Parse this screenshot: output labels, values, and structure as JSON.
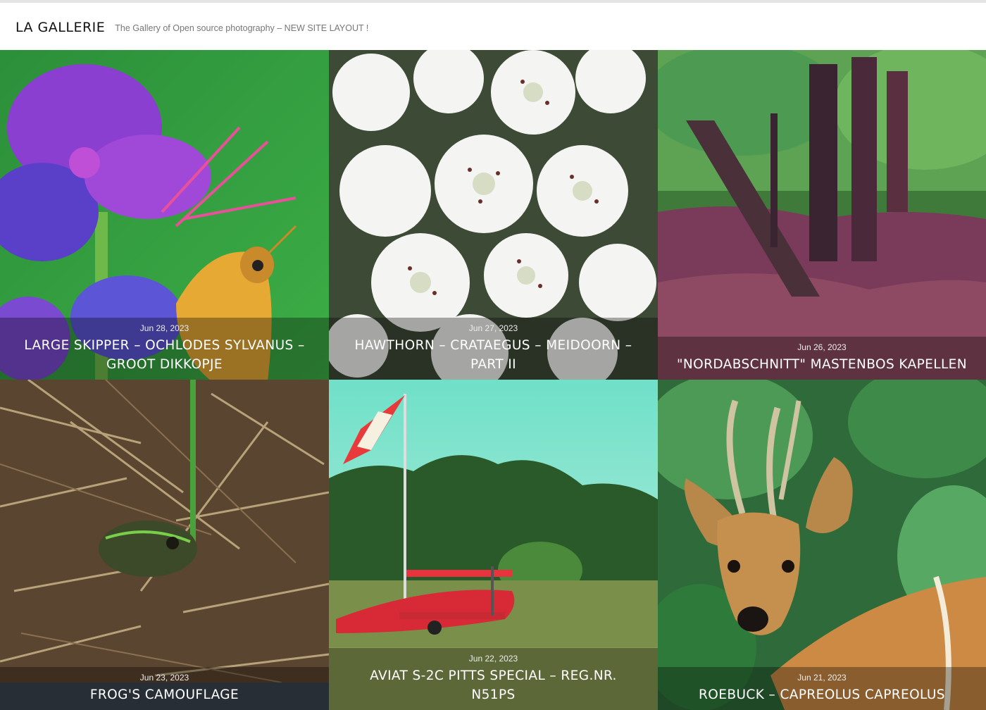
{
  "site": {
    "title": "LA GALLERIE",
    "tagline": "The Gallery of Open source photography – NEW SITE LAYOUT !"
  },
  "posts": [
    {
      "date": "Jun 28, 2023",
      "title": "LARGE SKIPPER – OCHLODES SYLVANUS – GROOT DIKKOPJE",
      "image": "skipper-butterfly-on-purple-flowers"
    },
    {
      "date": "Jun 27, 2023",
      "title": "HAWTHORN – CRATAEGUS – MEIDOORN – PART II",
      "image": "white-hawthorn-blossoms"
    },
    {
      "date": "Jun 26, 2023",
      "title": "\"NORDABSCHNITT\" MASTENBOS KAPELLEN",
      "image": "forest-with-trees"
    },
    {
      "date": "Jun 23, 2023",
      "title": "FROG'S CAMOUFLAGE",
      "image": "frog-in-dry-grass"
    },
    {
      "date": "Jun 22, 2023",
      "title": "AVIAT S-2C PITTS SPECIAL – REG.NR. N51PS",
      "image": "red-biplane-on-airfield"
    },
    {
      "date": "Jun 21, 2023",
      "title": "ROEBUCK – CAPREOLUS CAPREOLUS",
      "image": "roebuck-deer-portrait"
    }
  ]
}
